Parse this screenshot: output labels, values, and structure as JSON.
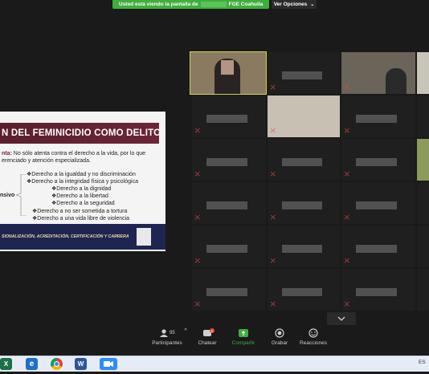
{
  "banner": {
    "text_pre": "Usted está viendo la pantalla de",
    "text_post": "FGE Coahuila",
    "view_options": "Ver Opciones"
  },
  "slide": {
    "title": "N DEL FEMINICIDIO COMO DELITO",
    "p_bold": "nta:",
    "p_line1": " No sólo atenta contra el derecho a la vida, por lo que",
    "p_line2": "erenciado y atención especializada.",
    "side_label": "nsivo",
    "bullets": [
      "❖Derecho a la igualdad y no discriminación",
      "❖Derecho a la integridad física y psicológica",
      "❖Derecho a la dignidad",
      "❖Derecho a la libertad",
      "❖Derecho a la seguridad",
      "❖Derecho a no ser sometida a tortura",
      "❖Derecho a una vida libre de violencia"
    ],
    "footer": "SIONALIZACIÓN, ACREDITACIÓN, CERTIFICACIÓN Y CARRERA"
  },
  "toolbar": {
    "participants_label": "Participantes",
    "participants_count": "95",
    "chat_label": "Chatear",
    "chat_badge": "1",
    "share_label": "Compartir",
    "record_label": "Grabar",
    "reactions_label": "Reacciones"
  },
  "taskbar": {
    "right_text": "ES"
  },
  "icons": [
    "people-icon",
    "chat-icon",
    "share-screen-icon",
    "record-icon",
    "reactions-icon",
    "chevron-down-icon",
    "excel-icon",
    "edge-icon",
    "chrome-icon",
    "word-icon",
    "zoom-icon"
  ],
  "colors": {
    "banner": "#3fae3c",
    "slide_title": "#5a1f2e",
    "slide_footer": "#1e2550",
    "active_speaker": "#c8d84a",
    "muted": "#e84a3c"
  }
}
